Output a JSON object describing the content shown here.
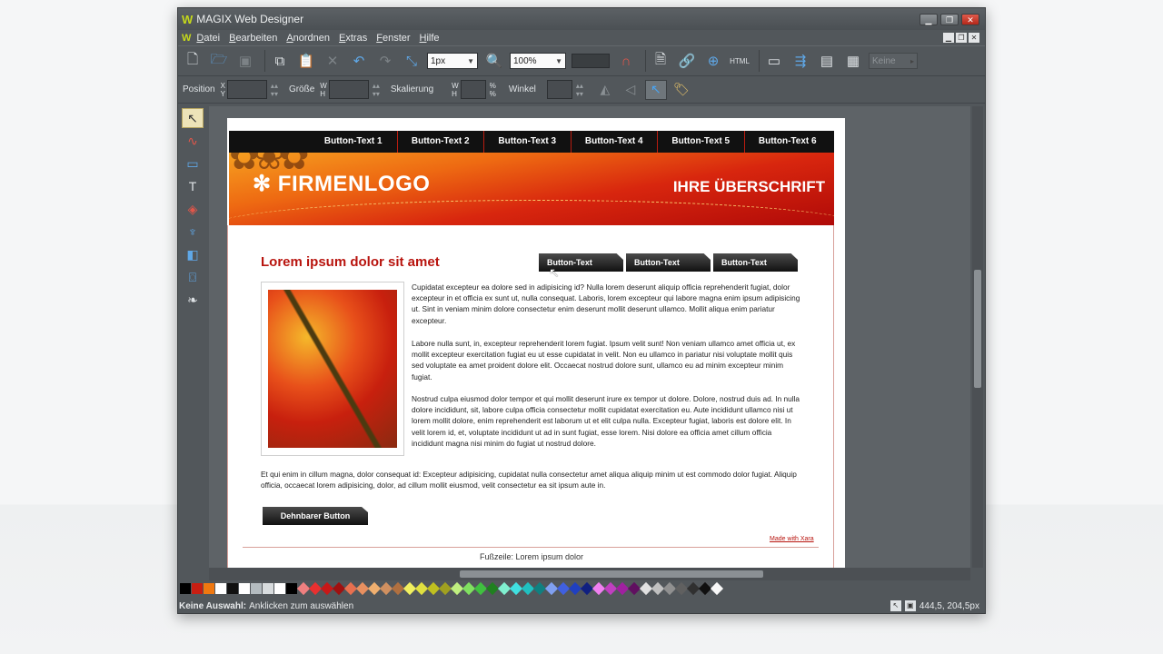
{
  "window": {
    "title": "MAGIX Web Designer",
    "controls": [
      "▁",
      "❐",
      "✕"
    ]
  },
  "menu": [
    "Datei",
    "Bearbeiten",
    "Anordnen",
    "Extras",
    "Fenster",
    "Hilfe"
  ],
  "toolbar": {
    "stroke_width": "1px",
    "zoom": "100%",
    "html_label": "HTML",
    "keine_label": "Keine"
  },
  "infobar": {
    "position_label": "Position",
    "x_label": "X",
    "y_label": "Y",
    "size_label": "Größe",
    "width_label": "W",
    "height_label": "H",
    "scale_label": "Skalierung",
    "percent_label": "%",
    "angle_label": "Winkel"
  },
  "page": {
    "nav_buttons": [
      "Button-Text 1",
      "Button-Text 2",
      "Button-Text 3",
      "Button-Text 4",
      "Button-Text 5",
      "Button-Text 6"
    ],
    "logo": "FIRMENLOGO",
    "headline": "IHRE ÜBERSCHRIFT",
    "heading": "Lorem ipsum dolor sit amet",
    "side_buttons": [
      "Button-Text",
      "Button-Text",
      "Button-Text"
    ],
    "paragraphs": [
      "Cupidatat excepteur ea dolore sed in adipisicing id? Nulla lorem deserunt aliquip officia reprehenderit fugiat, dolor excepteur in et officia ex sunt ut, nulla consequat. Laboris, lorem excepteur qui labore magna enim ipsum adipisicing ut. Sint in veniam minim dolore consectetur enim deserunt mollit deserunt ullamco. Mollit aliqua enim pariatur excepteur.",
      "Labore nulla sunt, in, excepteur reprehenderit lorem fugiat. Ipsum velit sunt! Non veniam ullamco amet officia ut, ex mollit excepteur exercitation fugiat eu ut esse cupidatat in velit. Non eu ullamco in pariatur nisi voluptate mollit quis sed voluptate ea amet proident dolore elit. Occaecat nostrud dolore sunt, ullamco eu ad minim excepteur minim fugiat.",
      "Nostrud culpa eiusmod dolor tempor et qui mollit deserunt irure ex tempor ut dolore. Dolore, nostrud duis ad. In nulla dolore incididunt, sit, labore culpa officia consectetur mollit cupidatat exercitation eu. Aute incididunt ullamco nisi ut lorem mollit dolore, enim reprehenderit est laborum ut et elit culpa nulla. Excepteur fugiat, laboris est dolore elit. In velit lorem id, et, voluptate incididunt ut ad in sunt fugiat, esse lorem. Nisi dolore ea officia amet cillum officia incididunt magna nisi minim do fugiat ut nostrud dolore."
    ],
    "full_paragraph": "Et qui enim in cillum magna, dolor consequat id: Excepteur adipisicing, cupidatat nulla consectetur amet aliqua aliquip minim ut est commodo dolor fugiat. Aliquip officia, occaecat lorem adipisicing, dolor, ad cillum mollit eiusmod, velit consectetur ea sit ipsum aute in.",
    "stretch_button": "Dehnbarer Button",
    "made_with": "Made with Xara",
    "footer": "Fußzeile: Lorem ipsum dolor"
  },
  "status": {
    "selection_bold": "Keine Auswahl:",
    "selection_hint": "Anklicken zum auswählen",
    "coords": "444,5, 204,5px"
  },
  "colors": {
    "accent_red": "#b8140e",
    "brand_green": "#c6d91a",
    "ui_dark": "#52575b"
  },
  "palette": {
    "swatches": [
      "#000000",
      "#c81e12",
      "#f07810",
      "#ffffff",
      "#111111",
      "#ffffff",
      "#b4bcc0",
      "#d8dcde",
      "#ffffff",
      "#000000"
    ],
    "diamonds": [
      "#f08080",
      "#e83030",
      "#c81818",
      "#a01010",
      "#e87050",
      "#e89060",
      "#f0b070",
      "#d09060",
      "#b07040",
      "#f0f060",
      "#e0e040",
      "#c0c020",
      "#a0a020",
      "#c0f080",
      "#80e060",
      "#40c040",
      "#208020",
      "#80f0d0",
      "#40e0e0",
      "#20c0c0",
      "#108080",
      "#80a0f0",
      "#4060e0",
      "#2040c0",
      "#102080",
      "#f080f0",
      "#c040c0",
      "#a020a0",
      "#601060",
      "#e0e0e0",
      "#c0c0c0",
      "#909090",
      "#606060",
      "#303030",
      "#101010",
      "#f8f8f8"
    ]
  }
}
